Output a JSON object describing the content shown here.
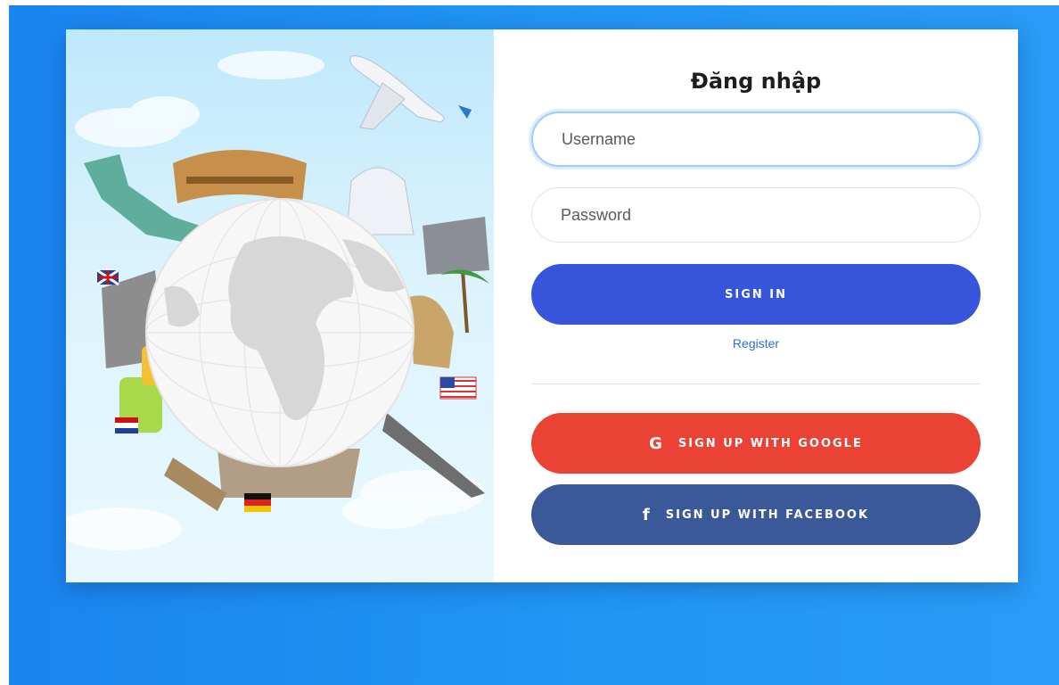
{
  "login": {
    "title": "Đăng nhập",
    "username_placeholder": "Username",
    "password_placeholder": "Password",
    "signin_label": "SIGN IN",
    "register_label": "Register",
    "google_label": "SIGN UP WITH GOOGLE",
    "facebook_label": "SIGN UP WITH FACEBOOK",
    "google_icon": "G",
    "facebook_icon": "f"
  },
  "colors": {
    "background_blue": "#2196f3",
    "signin_button": "#3655da",
    "google_button": "#ea4335",
    "facebook_button": "#3b5998",
    "register_link": "#2a6fd6",
    "focus_border": "#9fcdf5"
  },
  "illustration": {
    "subject": "travel-globe-illustration"
  }
}
